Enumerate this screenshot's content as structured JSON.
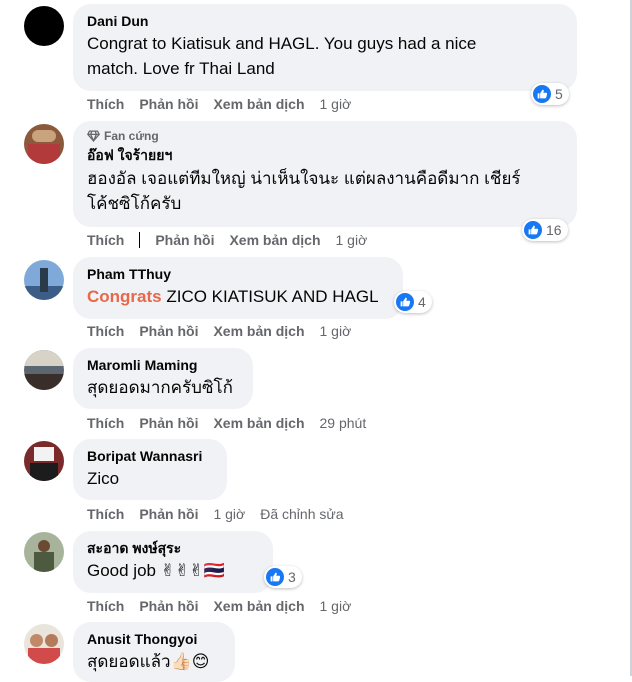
{
  "actions": {
    "like": "Thích",
    "reply": "Phản hồi",
    "translate": "Xem bản dịch"
  },
  "comments": [
    {
      "name": "Dani Dun",
      "text_line1": "Congrat to Kiatisuk and HAGL. You guys had a nice",
      "text_line2": "match. Love fr Thai Land",
      "time": "1 giờ",
      "likes": "5"
    },
    {
      "badge": "Fan cứng",
      "name": "อ๊อฟ ใจร้ายยฯ",
      "text_line1": "ฮองอัล เจอแต่ทีมใหญ่ น่าเห็นใจนะ แต่ผลงานคือดีมาก เชียร์",
      "text_line2": "โค้ชซิโก้ครับ",
      "time": "1 giờ",
      "likes": "16"
    },
    {
      "name": "Pham TThuy",
      "highlight": "Congrats",
      "text_rest": " ZICO KIATISUK AND HAGL",
      "time": "1 giờ",
      "likes": "4"
    },
    {
      "name": "Maromli Maming",
      "text": "สุดยอดมากครับซิโก้",
      "time": "29 phút"
    },
    {
      "name": "Boripat Wannasri",
      "text": "Zico",
      "time": "1 giờ",
      "edited": "Đã chỉnh sửa"
    },
    {
      "name": "สะอาด พงษ์สุระ",
      "text": "Good job ✌✌✌🇹🇭",
      "time": "1 giờ",
      "likes": "3"
    },
    {
      "name": "Anusit Thongyoi",
      "text": "สุดยอดแล้ว👍🏻😊"
    }
  ],
  "colors": {
    "like_blue": "#1877f2",
    "bubble_bg": "#f0f2f5",
    "muted": "#65676b",
    "highlight": "#e8684a"
  },
  "icons": [
    "thumbs-up-icon",
    "diamond-icon"
  ]
}
